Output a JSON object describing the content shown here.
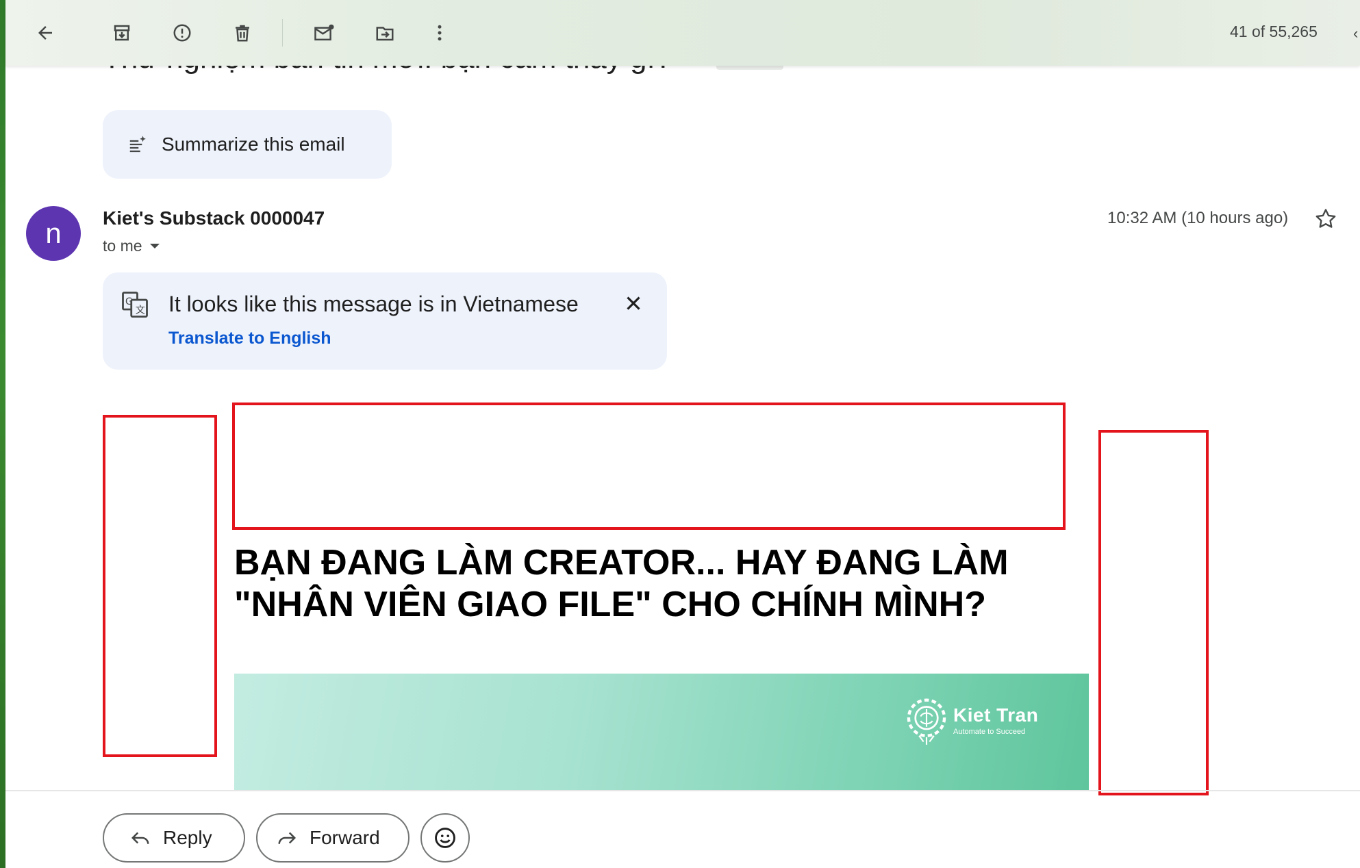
{
  "toolbar": {
    "back_icon": "arrow-left-icon",
    "archive_icon": "archive-icon",
    "report_spam_icon": "report-spam-icon",
    "delete_icon": "trash-icon",
    "mark_unread_icon": "mark-unread-icon",
    "move_to_icon": "move-to-icon",
    "more_icon": "more-vert-icon",
    "count": "41 of 55,265"
  },
  "email": {
    "subject_partial": "Thử nghiệm bản tin mới: bạn cảm thấy gì?",
    "summarize_label": "Summarize this email",
    "sender": {
      "avatar_letter": "n",
      "avatar_color": "#5e35b1",
      "name": "Kiet's Substack 0000047",
      "to": "to me",
      "time": "10:32 AM (10 hours ago)"
    },
    "translate_banner": {
      "message": "It looks like this message is in Vietnamese",
      "link": "Translate to English"
    },
    "headline": "BẠN ĐANG LÀM CREATOR... HAY ĐANG LÀM \"NHÂN VIÊN GIAO FILE\" CHO CHÍNH MÌNH?",
    "banner": {
      "brand_name": "Kiet Tran",
      "brand_tagline": "Automate to Succeed"
    }
  },
  "actions": {
    "reply": "Reply",
    "forward": "Forward",
    "emoji_icon": "emoji-icon"
  },
  "colors": {
    "accent_link": "#0b57d0",
    "placeholder_border": "#e3141c",
    "chip_bg": "#eef2fb"
  }
}
